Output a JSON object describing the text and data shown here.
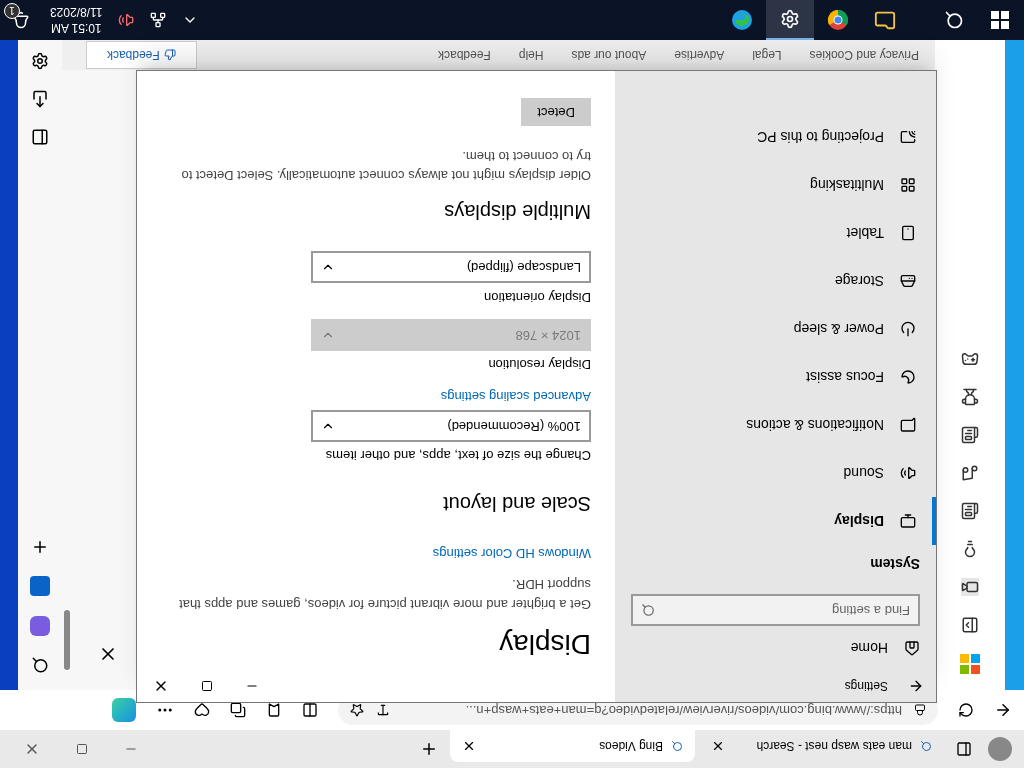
{
  "browser": {
    "tabs": [
      {
        "label": "man eats wasp nest - Search",
        "selected": false
      },
      {
        "label": "Bing Videos",
        "selected": true
      }
    ],
    "address": "https://www.bing.com/videos/riverview/relatedvideo?q=man+eats+wasp+n...",
    "page": {
      "footer_links": [
        "Privacy and Cookies",
        "Legal",
        "Advertise",
        "About our ads",
        "Help",
        "Feedback"
      ],
      "feedback_button": "Feedback"
    }
  },
  "settings": {
    "title": "Settings",
    "nav": {
      "home": "Home",
      "search_placeholder": "Find a setting",
      "section": "System",
      "items": [
        {
          "label": "Display",
          "selected": true
        },
        {
          "label": "Sound",
          "selected": false
        },
        {
          "label": "Notifications & actions",
          "selected": false
        },
        {
          "label": "Focus assist",
          "selected": false
        },
        {
          "label": "Power & sleep",
          "selected": false
        },
        {
          "label": "Storage",
          "selected": false
        },
        {
          "label": "Tablet",
          "selected": false
        },
        {
          "label": "Multitasking",
          "selected": false
        },
        {
          "label": "Projecting to this PC",
          "selected": false
        }
      ]
    },
    "content": [
      {
        "kind": "heading",
        "text": "Display"
      },
      {
        "kind": "text",
        "text": "Get a brighter and more vibrant picture for videos, games and apps that support HDR."
      },
      {
        "kind": "link",
        "text": "Windows HD Color settings"
      },
      {
        "kind": "subheading",
        "text": "Scale and layout"
      },
      {
        "kind": "label",
        "text": "Change the size of text, apps, and other items"
      },
      {
        "kind": "dropdown",
        "text": "100% (Recommended)",
        "disabled": false
      },
      {
        "kind": "link",
        "text": "Advanced scaling settings"
      },
      {
        "kind": "label",
        "text": "Display resolution"
      },
      {
        "kind": "dropdown",
        "text": "1024 × 768",
        "disabled": true
      },
      {
        "kind": "label",
        "text": "Display orientation"
      },
      {
        "kind": "dropdown",
        "text": "Landscape (flipped)",
        "disabled": false
      },
      {
        "kind": "subheading",
        "text": "Multiple displays"
      },
      {
        "kind": "text",
        "text": "Older displays might not always connect automatically. Select Detect to try to connect to them."
      },
      {
        "kind": "button",
        "text": "Detect"
      }
    ]
  },
  "taskbar": {
    "time": "10:51 AM",
    "date": "11/8/2023",
    "notification_count": "1"
  }
}
